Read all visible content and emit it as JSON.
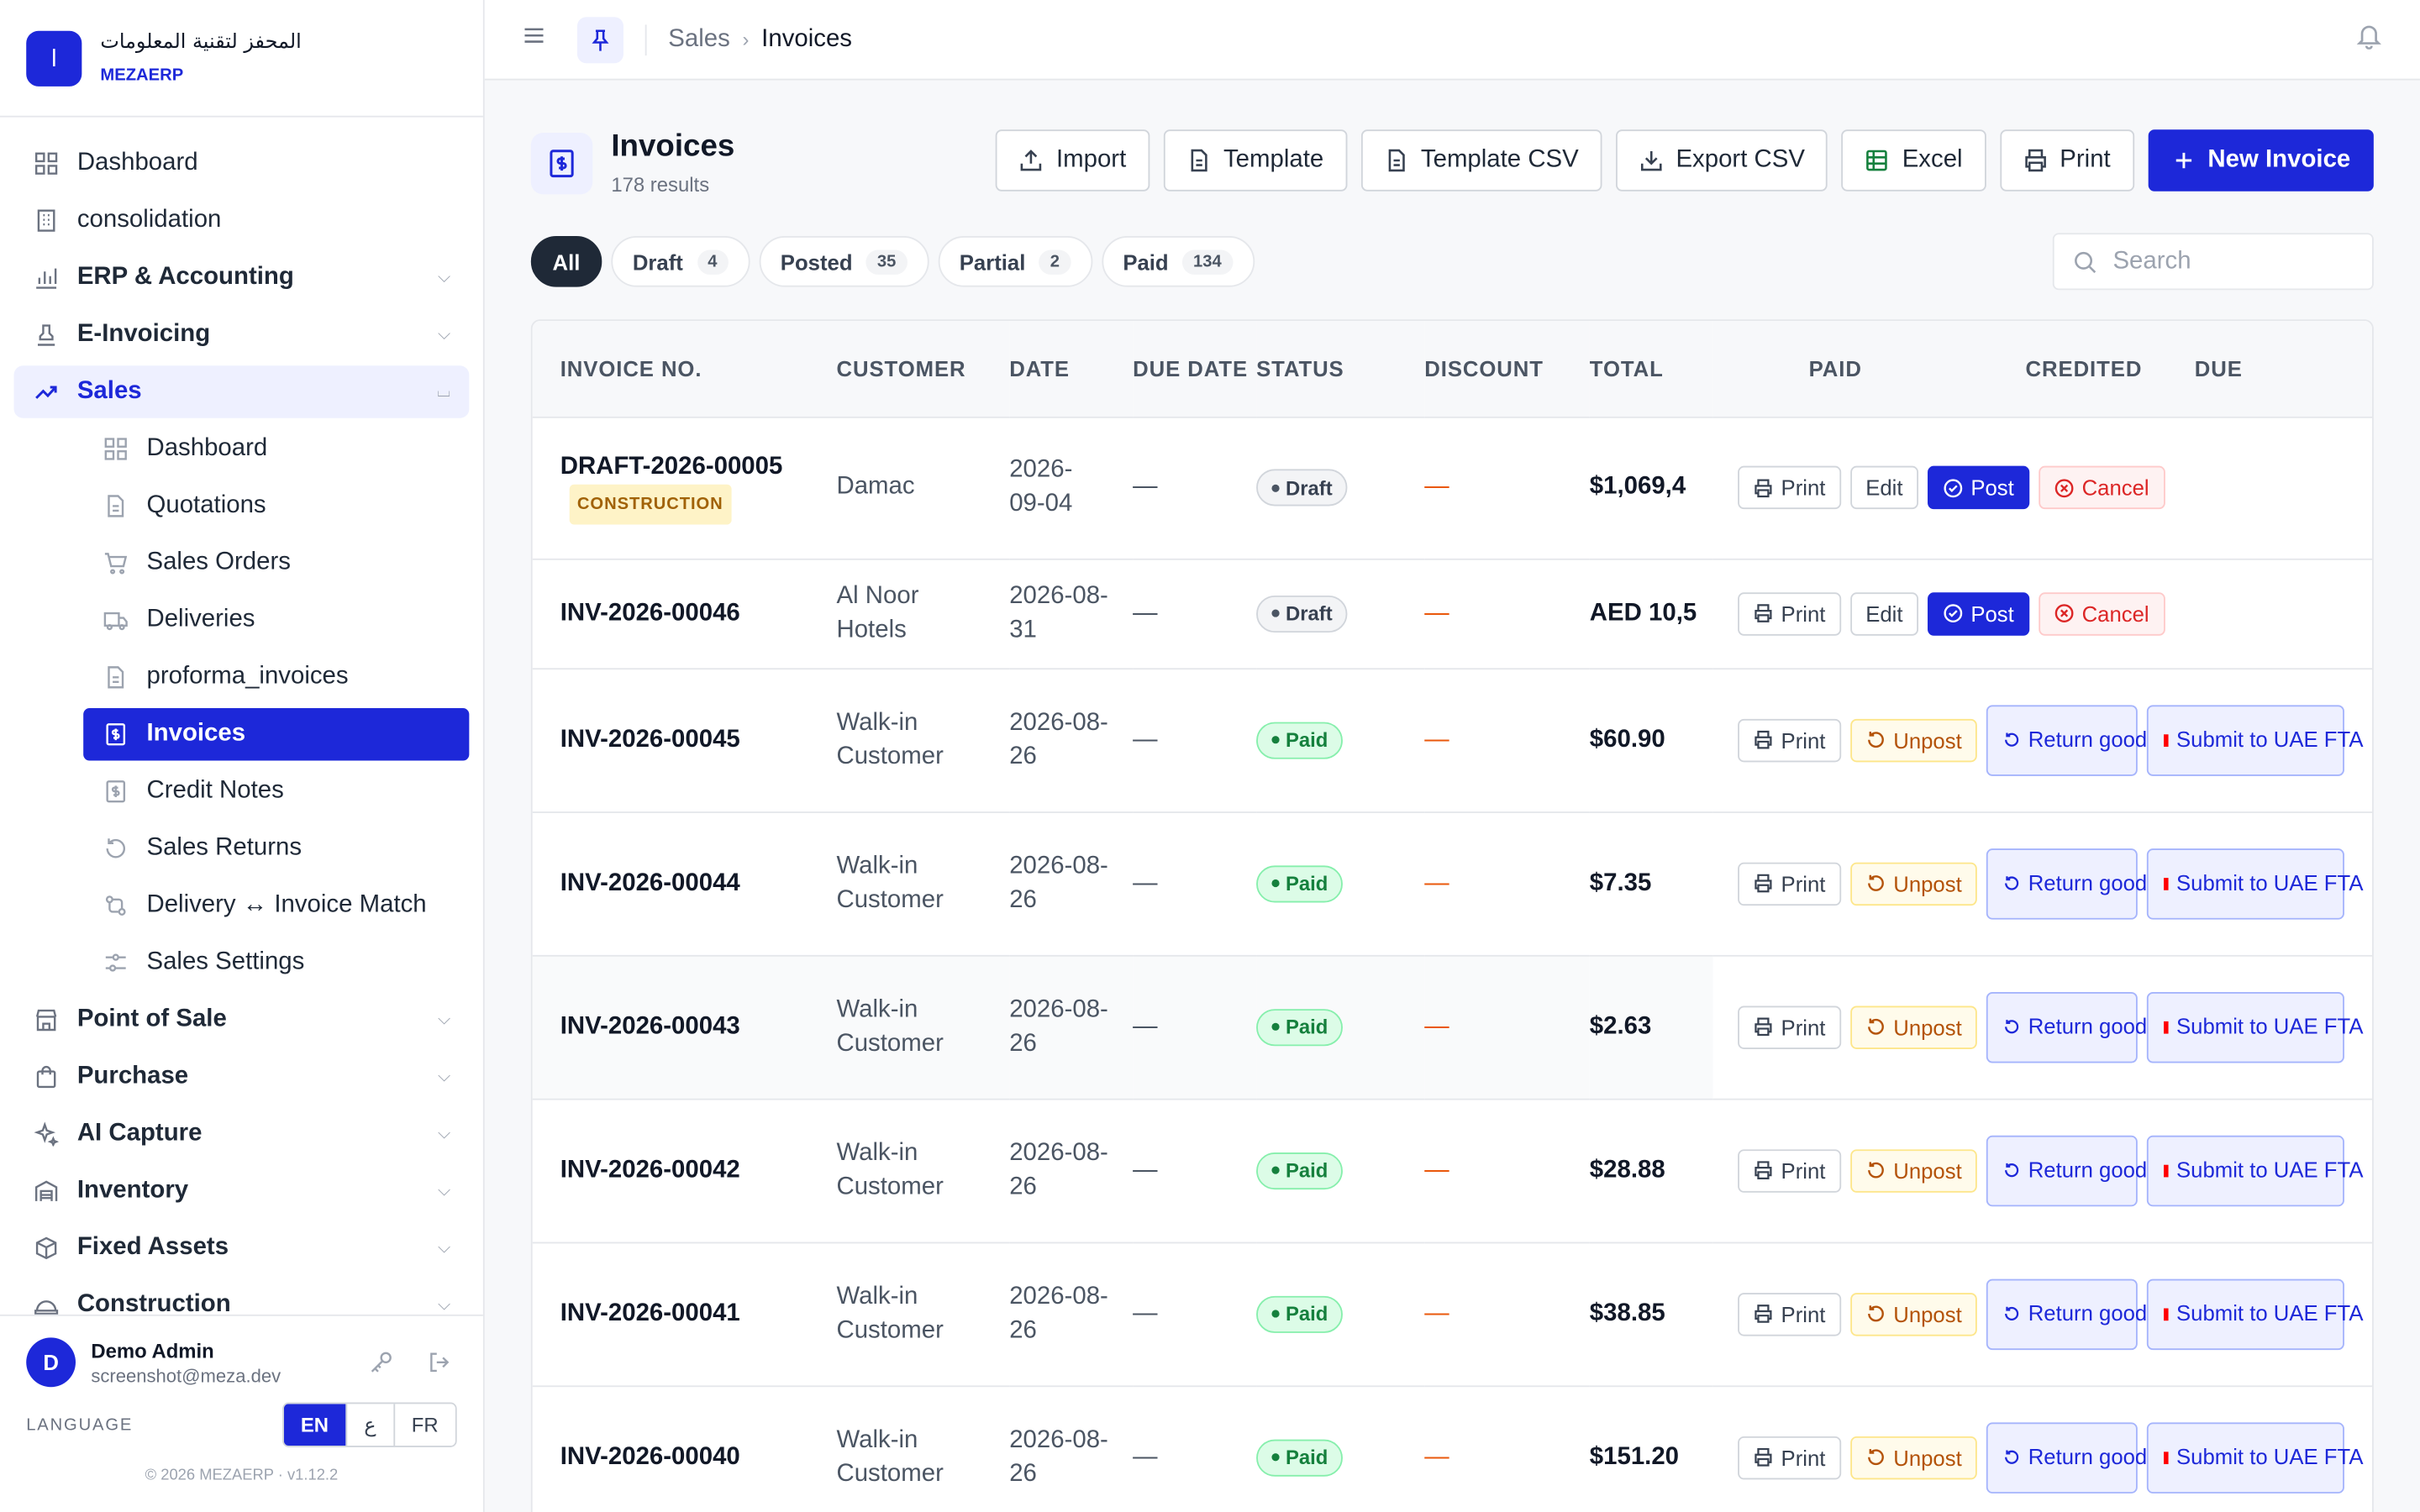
{
  "brand": {
    "logo_letter": "ا",
    "name": "المحفز لتقنية المعلومات",
    "sub": "MEZAERP"
  },
  "nav": {
    "top_items": [
      {
        "label": "Dashboard",
        "icon": "grid-icon"
      },
      {
        "label": "consolidation",
        "icon": "building-icon"
      },
      {
        "label": "ERP & Accounting",
        "icon": "bar-chart-icon"
      },
      {
        "label": "E-Invoicing",
        "icon": "stamp-icon"
      },
      {
        "label": "Sales",
        "icon": "trend-up-icon"
      }
    ],
    "sales_sub": [
      {
        "label": "Dashboard"
      },
      {
        "label": "Quotations"
      },
      {
        "label": "Sales Orders"
      },
      {
        "label": "Deliveries"
      },
      {
        "label": "proforma_invoices"
      },
      {
        "label": "Invoices"
      },
      {
        "label": "Credit Notes"
      },
      {
        "label": "Sales Returns"
      },
      {
        "label": "Delivery ↔ Invoice Match"
      },
      {
        "label": "Sales Settings"
      }
    ],
    "bottom_items": [
      {
        "label": "Point of Sale"
      },
      {
        "label": "Purchase"
      },
      {
        "label": "AI Capture"
      },
      {
        "label": "Inventory"
      },
      {
        "label": "Fixed Assets"
      },
      {
        "label": "Construction"
      }
    ]
  },
  "user": {
    "initial": "D",
    "name": "Demo Admin",
    "email": "screenshot@meza.dev"
  },
  "language": {
    "label": "LANGUAGE",
    "options": [
      "EN",
      "ع",
      "FR"
    ],
    "selected": "EN"
  },
  "copyright": "© 2026 MEZAERP · v1.12.2",
  "breadcrumb": {
    "parent": "Sales",
    "current": "Invoices"
  },
  "page": {
    "title": "Invoices",
    "subtitle": "178 results"
  },
  "toolbar": {
    "import": "Import",
    "template": "Template",
    "template_csv": "Template CSV",
    "export_csv": "Export CSV",
    "excel": "Excel",
    "print": "Print",
    "new_invoice": "New Invoice"
  },
  "filters": [
    {
      "label": "All",
      "count": ""
    },
    {
      "label": "Draft",
      "count": "4"
    },
    {
      "label": "Posted",
      "count": "35"
    },
    {
      "label": "Partial",
      "count": "2"
    },
    {
      "label": "Paid",
      "count": "134"
    }
  ],
  "search": {
    "placeholder": "Search"
  },
  "table": {
    "headers": {
      "invoice_no": "INVOICE NO.",
      "customer": "CUSTOMER",
      "date": "DATE",
      "due_date": "DUE DATE",
      "status": "STATUS",
      "discount": "DISCOUNT",
      "total": "TOTAL",
      "paid": "PAID",
      "credited": "CREDITED",
      "due": "DUE"
    },
    "actions": {
      "print": "Print",
      "edit": "Edit",
      "post": "Post",
      "cancel": "Cancel",
      "unpost": "Unpost",
      "return_goods": "Return goods",
      "submit_fta": "Submit to UAE FTA"
    },
    "rows": [
      {
        "no": "DRAFT-2026-00005",
        "tag": "CONSTRUCTION",
        "customer": "Damac",
        "date": "2026-09-04",
        "due_date": "—",
        "status": "Draft",
        "discount": "—",
        "total": "$1,069,4"
      },
      {
        "no": "INV-2026-00046",
        "tag": "",
        "customer": "Al Noor Hotels",
        "date": "2026-08-31",
        "due_date": "—",
        "status": "Draft",
        "discount": "—",
        "total": "AED 10,5"
      },
      {
        "no": "INV-2026-00045",
        "tag": "",
        "customer": "Walk-in Customer",
        "date": "2026-08-26",
        "due_date": "—",
        "status": "Paid",
        "discount": "—",
        "total": "$60.90"
      },
      {
        "no": "INV-2026-00044",
        "tag": "",
        "customer": "Walk-in Customer",
        "date": "2026-08-26",
        "due_date": "—",
        "status": "Paid",
        "discount": "—",
        "total": "$7.35"
      },
      {
        "no": "INV-2026-00043",
        "tag": "",
        "customer": "Walk-in Customer",
        "date": "2026-08-26",
        "due_date": "—",
        "status": "Paid",
        "discount": "—",
        "total": "$2.63"
      },
      {
        "no": "INV-2026-00042",
        "tag": "",
        "customer": "Walk-in Customer",
        "date": "2026-08-26",
        "due_date": "—",
        "status": "Paid",
        "discount": "—",
        "total": "$28.88"
      },
      {
        "no": "INV-2026-00041",
        "tag": "",
        "customer": "Walk-in Customer",
        "date": "2026-08-26",
        "due_date": "—",
        "status": "Paid",
        "discount": "—",
        "total": "$38.85"
      },
      {
        "no": "INV-2026-00040",
        "tag": "",
        "customer": "Walk-in Customer",
        "date": "2026-08-26",
        "due_date": "—",
        "status": "Paid",
        "discount": "—",
        "total": "$151.20"
      }
    ]
  },
  "colors": {
    "accent": "#1d28d9",
    "paid": "#15803d",
    "discount": "#ea580c"
  }
}
